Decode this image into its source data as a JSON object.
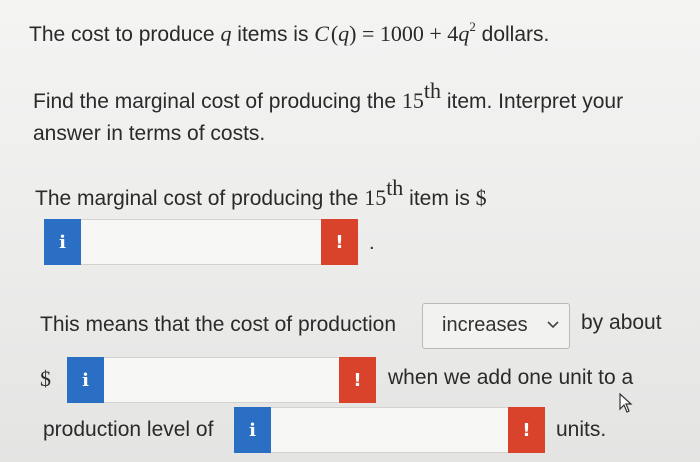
{
  "problem": {
    "line1_a": "The cost to produce ",
    "line1_var": "q",
    "line1_b": " items is ",
    "line1_fn": "C",
    "line1_arg": "q",
    "line1_eq": " = 1000 + 4",
    "line1_q": "q",
    "line1_exp": "2",
    "line1_units": " dollars.",
    "line2_a": "Find the marginal cost of producing the ",
    "line2_num": "15",
    "line2_sup": "th",
    "line2_b": " item. Interpret your",
    "line3": "answer in terms of costs."
  },
  "answer1": {
    "text_a": "The marginal cost of producing the ",
    "num": "15",
    "sup": "th",
    "text_b": " item is ",
    "dollar": "$",
    "input_value": "",
    "info_icon": "i",
    "error_icon": "!",
    "period": "."
  },
  "answer2": {
    "text": "This means that the cost of production",
    "select_value": "increases",
    "select_icon": "chevron-down-icon",
    "text_after": "by about",
    "dollar": "$",
    "input_value": "",
    "info_icon": "i",
    "error_icon": "!",
    "text_when": "when we add one unit to a"
  },
  "answer3": {
    "text": "production level of",
    "input_value": "",
    "info_icon": "i",
    "error_icon": "!",
    "text_after": "units."
  },
  "colors": {
    "info": "#2a6fc4",
    "error": "#d9432c"
  }
}
